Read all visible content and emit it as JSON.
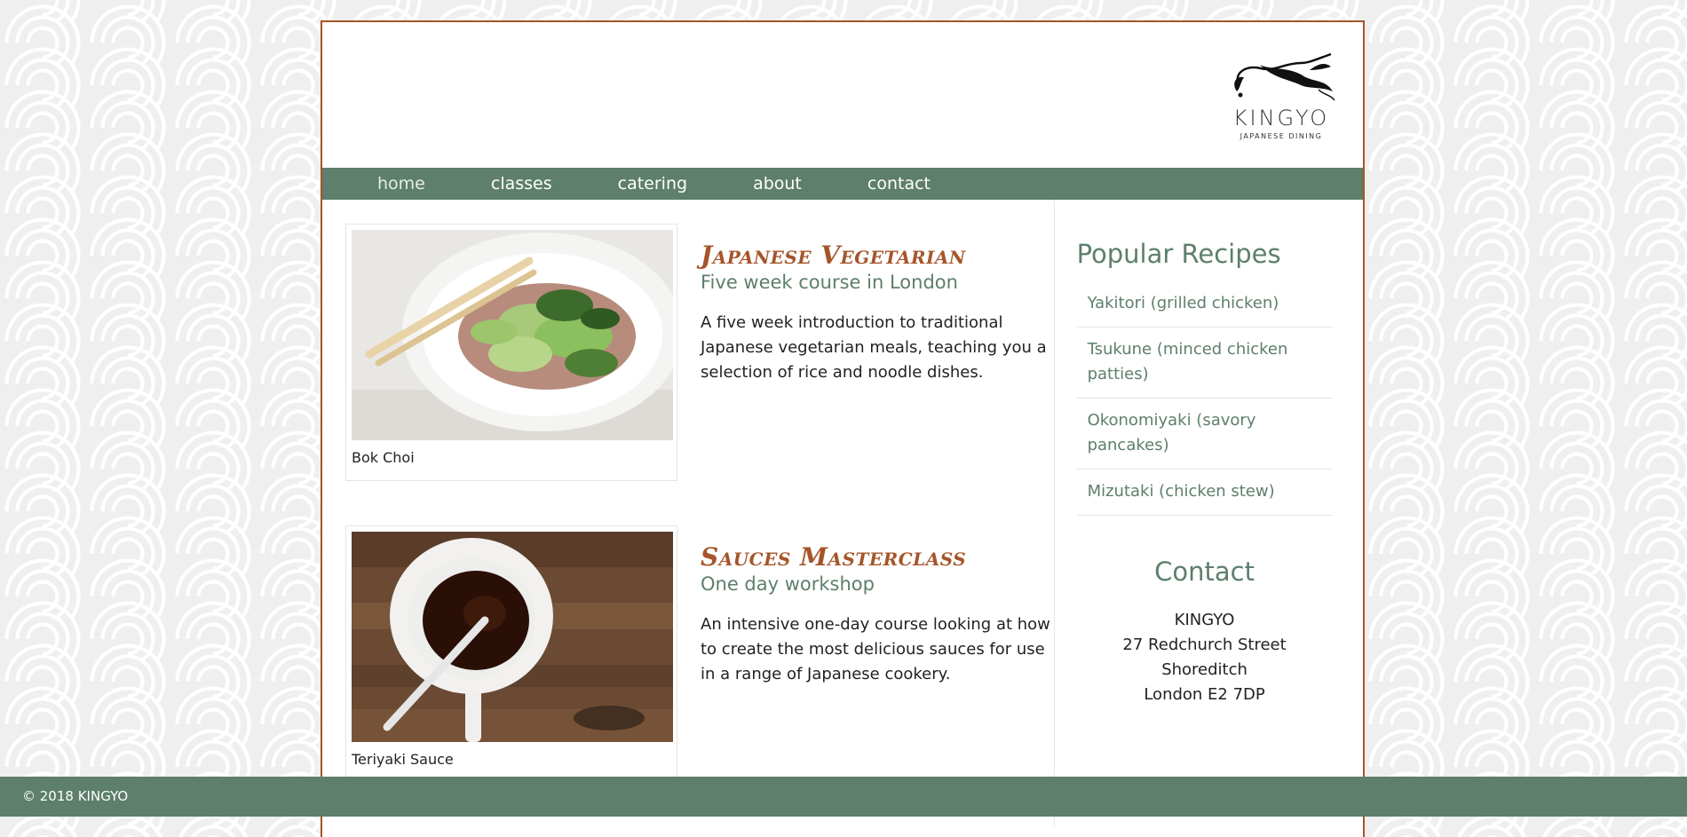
{
  "logo": {
    "name": "KINGYO",
    "tagline": "JAPANESE DINING"
  },
  "nav": {
    "items": [
      {
        "label": "home"
      },
      {
        "label": "classes"
      },
      {
        "label": "catering"
      },
      {
        "label": "about"
      },
      {
        "label": "contact"
      }
    ]
  },
  "courses": [
    {
      "caption": "Bok Choi",
      "title": "Japanese Vegetarian",
      "subtitle": "Five week course in London",
      "description": "A five week introduction to traditional Japanese vegetarian meals, teaching you a selection of rice and noodle dishes."
    },
    {
      "caption": "Teriyaki Sauce",
      "title": "Sauces Masterclass",
      "subtitle": "One day workshop",
      "description": "An intensive one-day course looking at how to create the most delicious sauces for use in a range of Japanese cookery."
    }
  ],
  "sidebar": {
    "recipes_title": "Popular Recipes",
    "recipes": [
      "Yakitori (grilled chicken)",
      "Tsukune (minced chicken patties)",
      "Okonomiyaki (savory pancakes)",
      "Mizutaki (chicken stew)"
    ],
    "contact_title": "Contact",
    "address": [
      "KINGYO",
      "27 Redchurch Street",
      "Shoreditch",
      "London E2 7DP"
    ]
  },
  "footer": {
    "copyright": "© 2018 KINGYO"
  },
  "colors": {
    "accent_green": "#5d7f6b",
    "accent_rust": "#a5552a"
  }
}
